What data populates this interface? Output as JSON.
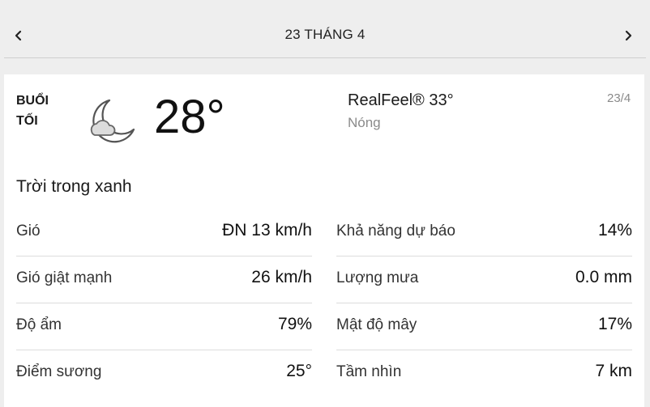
{
  "nav": {
    "prev_icon": "chevron-left-icon",
    "date_title": "23 THÁNG 4",
    "next_icon": "chevron-right-icon"
  },
  "current": {
    "period_line1": "BUỔI",
    "period_line2": "TỐI",
    "weather_icon": "moon-cloud-icon",
    "temperature": "28°",
    "realfeel": "RealFeel® 33°",
    "realfeel_desc": "Nóng",
    "short_date": "23/4",
    "condition": "Trời trong xanh"
  },
  "details_left": [
    {
      "label": "Gió",
      "value": "ĐN 13 km/h"
    },
    {
      "label": "Gió giật mạnh",
      "value": "26 km/h"
    },
    {
      "label": "Độ ẩm",
      "value": "79%"
    },
    {
      "label": "Điểm sương",
      "value": "25°"
    }
  ],
  "details_right": [
    {
      "label": "Khả năng dự báo",
      "value": "14%"
    },
    {
      "label": "Lượng mưa",
      "value": "0.0 mm"
    },
    {
      "label": "Mật độ mây",
      "value": "17%"
    },
    {
      "label": "Tầm nhìn",
      "value": "7 km"
    }
  ]
}
